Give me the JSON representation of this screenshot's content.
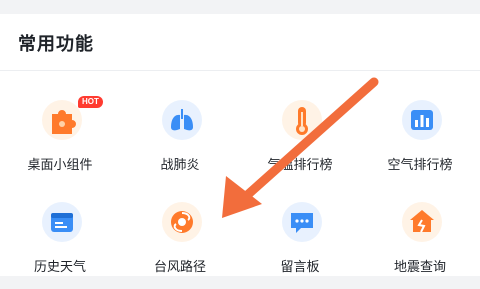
{
  "section": {
    "title": "常用功能"
  },
  "tiles": [
    {
      "label": "桌面小组件",
      "icon": "puzzle-icon",
      "badge": "HOT"
    },
    {
      "label": "战肺炎",
      "icon": "lungs-icon"
    },
    {
      "label": "气温排行榜",
      "icon": "thermometer-icon"
    },
    {
      "label": "空气排行榜",
      "icon": "bar-chart-icon"
    },
    {
      "label": "历史天气",
      "icon": "calendar-icon"
    },
    {
      "label": "台风路径",
      "icon": "typhoon-icon"
    },
    {
      "label": "留言板",
      "icon": "message-icon"
    },
    {
      "label": "地震查询",
      "icon": "earthquake-icon"
    }
  ],
  "colors": {
    "accent_orange": "#ff7a2b",
    "accent_blue": "#3a8ef6",
    "badge_red": "#ff3b30",
    "annotation_arrow": "#f26d3c"
  }
}
